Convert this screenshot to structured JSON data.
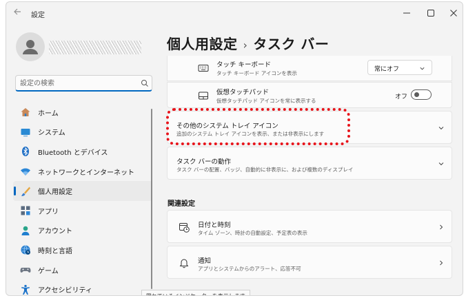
{
  "window": {
    "title": "設定",
    "back_icon": "arrow-left-icon",
    "controls": [
      "minimize-icon",
      "maximize-icon",
      "close-icon"
    ]
  },
  "search": {
    "placeholder": "設定の検索"
  },
  "sidebar": {
    "items": [
      {
        "label": "ホーム",
        "icon": "home-icon"
      },
      {
        "label": "システム",
        "icon": "display-icon"
      },
      {
        "label": "Bluetooth とデバイス",
        "icon": "bluetooth-icon"
      },
      {
        "label": "ネットワークとインターネット",
        "icon": "wifi-icon"
      },
      {
        "label": "個人用設定",
        "icon": "brush-icon",
        "selected": true
      },
      {
        "label": "アプリ",
        "icon": "apps-icon"
      },
      {
        "label": "アカウント",
        "icon": "person-icon"
      },
      {
        "label": "時刻と言語",
        "icon": "globe-clock-icon"
      },
      {
        "label": "ゲーム",
        "icon": "gamepad-icon"
      },
      {
        "label": "アクセシビリティ",
        "icon": "accessibility-icon"
      }
    ]
  },
  "breadcrumb": {
    "parent": "個人用設定",
    "separator": "›",
    "current": "タスク バー"
  },
  "settings": {
    "touch_keyboard": {
      "title": "タッチ キーボード",
      "desc": "タッチ キーボード アイコンを表示",
      "dropdown_value": "常にオフ"
    },
    "virtual_touchpad": {
      "title": "仮想タッチパッド",
      "desc": "仮想タッチパッド アイコンを常に表示する",
      "toggle_label": "オフ",
      "toggle_on": false
    },
    "other_tray_icons": {
      "title": "その他のシステム トレイ アイコン",
      "desc": "追加のシステム トレイ アイコンを表示、または非表示にします"
    },
    "taskbar_behaviors": {
      "title": "タスク バーの動作",
      "desc": "タスク バーの配置、バッジ、自動的に非表示に、および複数のディスプレイ"
    }
  },
  "related": {
    "heading": "関連設定",
    "items": [
      {
        "title": "日付と時刻",
        "desc": "タイム ゾーン、時計の自動設定、予定表の表示",
        "icon": "calendar-clock-icon"
      },
      {
        "title": "通知",
        "desc": "アプリとシステムからのアラート、応答不可",
        "icon": "bell-icon"
      }
    ]
  },
  "tooltip": {
    "text": "隠れているインジケーターを表示します"
  },
  "colors": {
    "accent": "#0067c0",
    "highlight": "#e8141b",
    "window_bg": "#f3f3f3",
    "card_bg": "#fbfbfb"
  }
}
